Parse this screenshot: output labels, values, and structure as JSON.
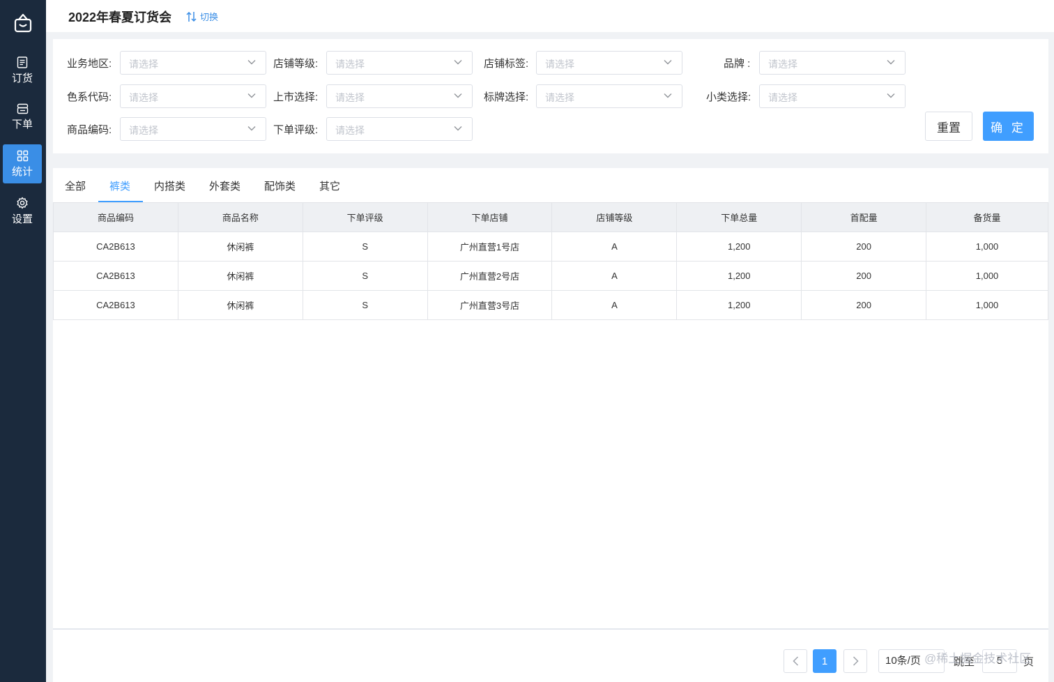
{
  "sidebar": {
    "logo": "bag-icon",
    "items": [
      {
        "label": "订货",
        "icon": "list-icon",
        "active": false
      },
      {
        "label": "下单",
        "icon": "store-icon",
        "active": false
      },
      {
        "label": "统计",
        "icon": "grid-icon",
        "active": true
      },
      {
        "label": "设置",
        "icon": "gear-icon",
        "active": false
      }
    ]
  },
  "header": {
    "title": "2022年春夏订货会",
    "switch_label": "切换"
  },
  "filters": {
    "placeholder": "请选择",
    "labels": {
      "region": "业务地区:",
      "store_level": "店铺等级:",
      "store_tag": "店铺标签:",
      "brand": "品牌 :",
      "color_code": "色系代码:",
      "launch": "上市选择:",
      "label_select": "标牌选择:",
      "subcategory": "小类选择:",
      "product_code": "商品编码:",
      "order_rating": "下单评级:"
    },
    "reset_label": "重置",
    "confirm_label": "确 定"
  },
  "tabs": [
    "全部",
    "裤类",
    "内搭类",
    "外套类",
    "配饰类",
    "其它"
  ],
  "active_tab": "裤类",
  "table": {
    "headers": [
      "商品编码",
      "商品名称",
      "下单评级",
      "下单店铺",
      "店铺等级",
      "下单总量",
      "首配量",
      "备货量"
    ],
    "rows": [
      [
        "CA2B613",
        "休闲裤",
        "S",
        "广州直营1号店",
        "A",
        "1,200",
        "200",
        "1,000"
      ],
      [
        "CA2B613",
        "休闲裤",
        "S",
        "广州直营2号店",
        "A",
        "1,200",
        "200",
        "1,000"
      ],
      [
        "CA2B613",
        "休闲裤",
        "S",
        "广州直营3号店",
        "A",
        "1,200",
        "200",
        "1,000"
      ]
    ]
  },
  "pagination": {
    "current_page": "1",
    "page_size": "10条/页",
    "jump_label": "跳至",
    "jump_value": "5",
    "page_suffix": "页",
    "watermark": "@稀土掘金技术社区"
  },
  "colors": {
    "sidebar_bg": "#1b2a3d",
    "accent": "#409eff"
  }
}
